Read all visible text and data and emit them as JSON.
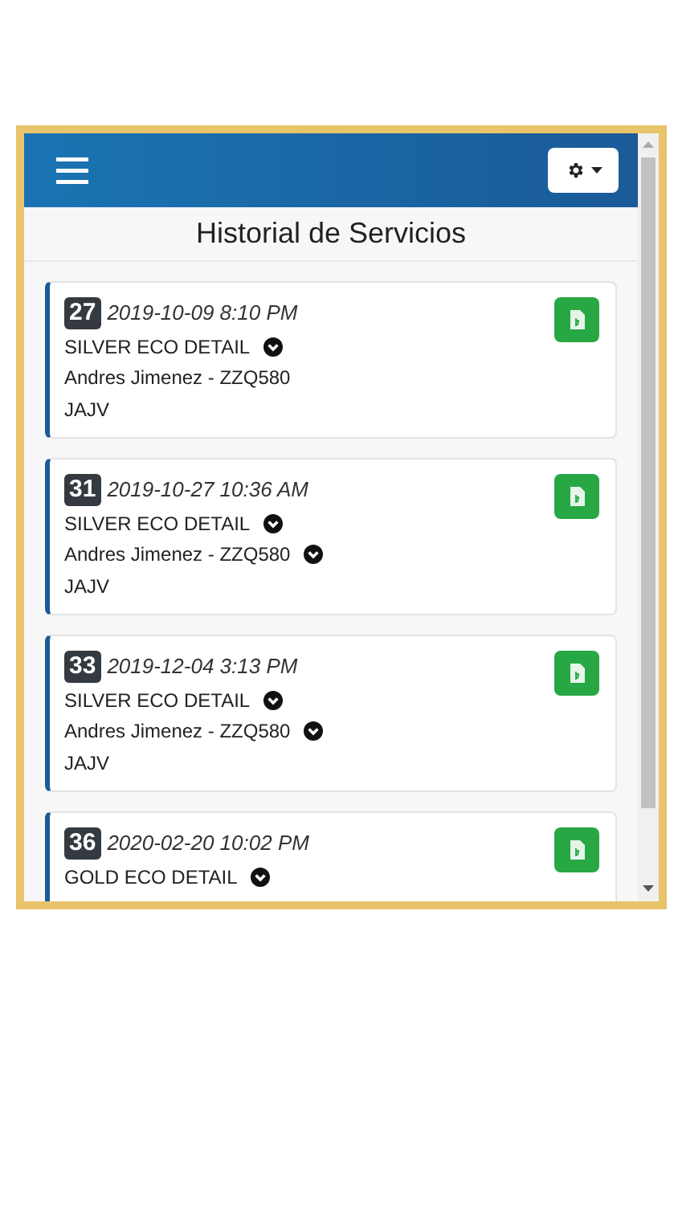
{
  "title": "Historial de Servicios",
  "services": [
    {
      "number": "27",
      "date": "2019-10-09 8:10 PM",
      "service": "SILVER ECO DETAIL",
      "customer": "Andres Jimenez - ZZQ580",
      "customer_expandable": false,
      "code": "JAJV"
    },
    {
      "number": "31",
      "date": "2019-10-27 10:36 AM",
      "service": "SILVER ECO DETAIL",
      "customer": "Andres Jimenez - ZZQ580",
      "customer_expandable": true,
      "code": "JAJV"
    },
    {
      "number": "33",
      "date": "2019-12-04 3:13 PM",
      "service": "SILVER ECO DETAIL",
      "customer": "Andres Jimenez - ZZQ580",
      "customer_expandable": true,
      "code": "JAJV"
    },
    {
      "number": "36",
      "date": "2020-02-20 10:02 PM",
      "service": "GOLD ECO DETAIL"
    }
  ]
}
